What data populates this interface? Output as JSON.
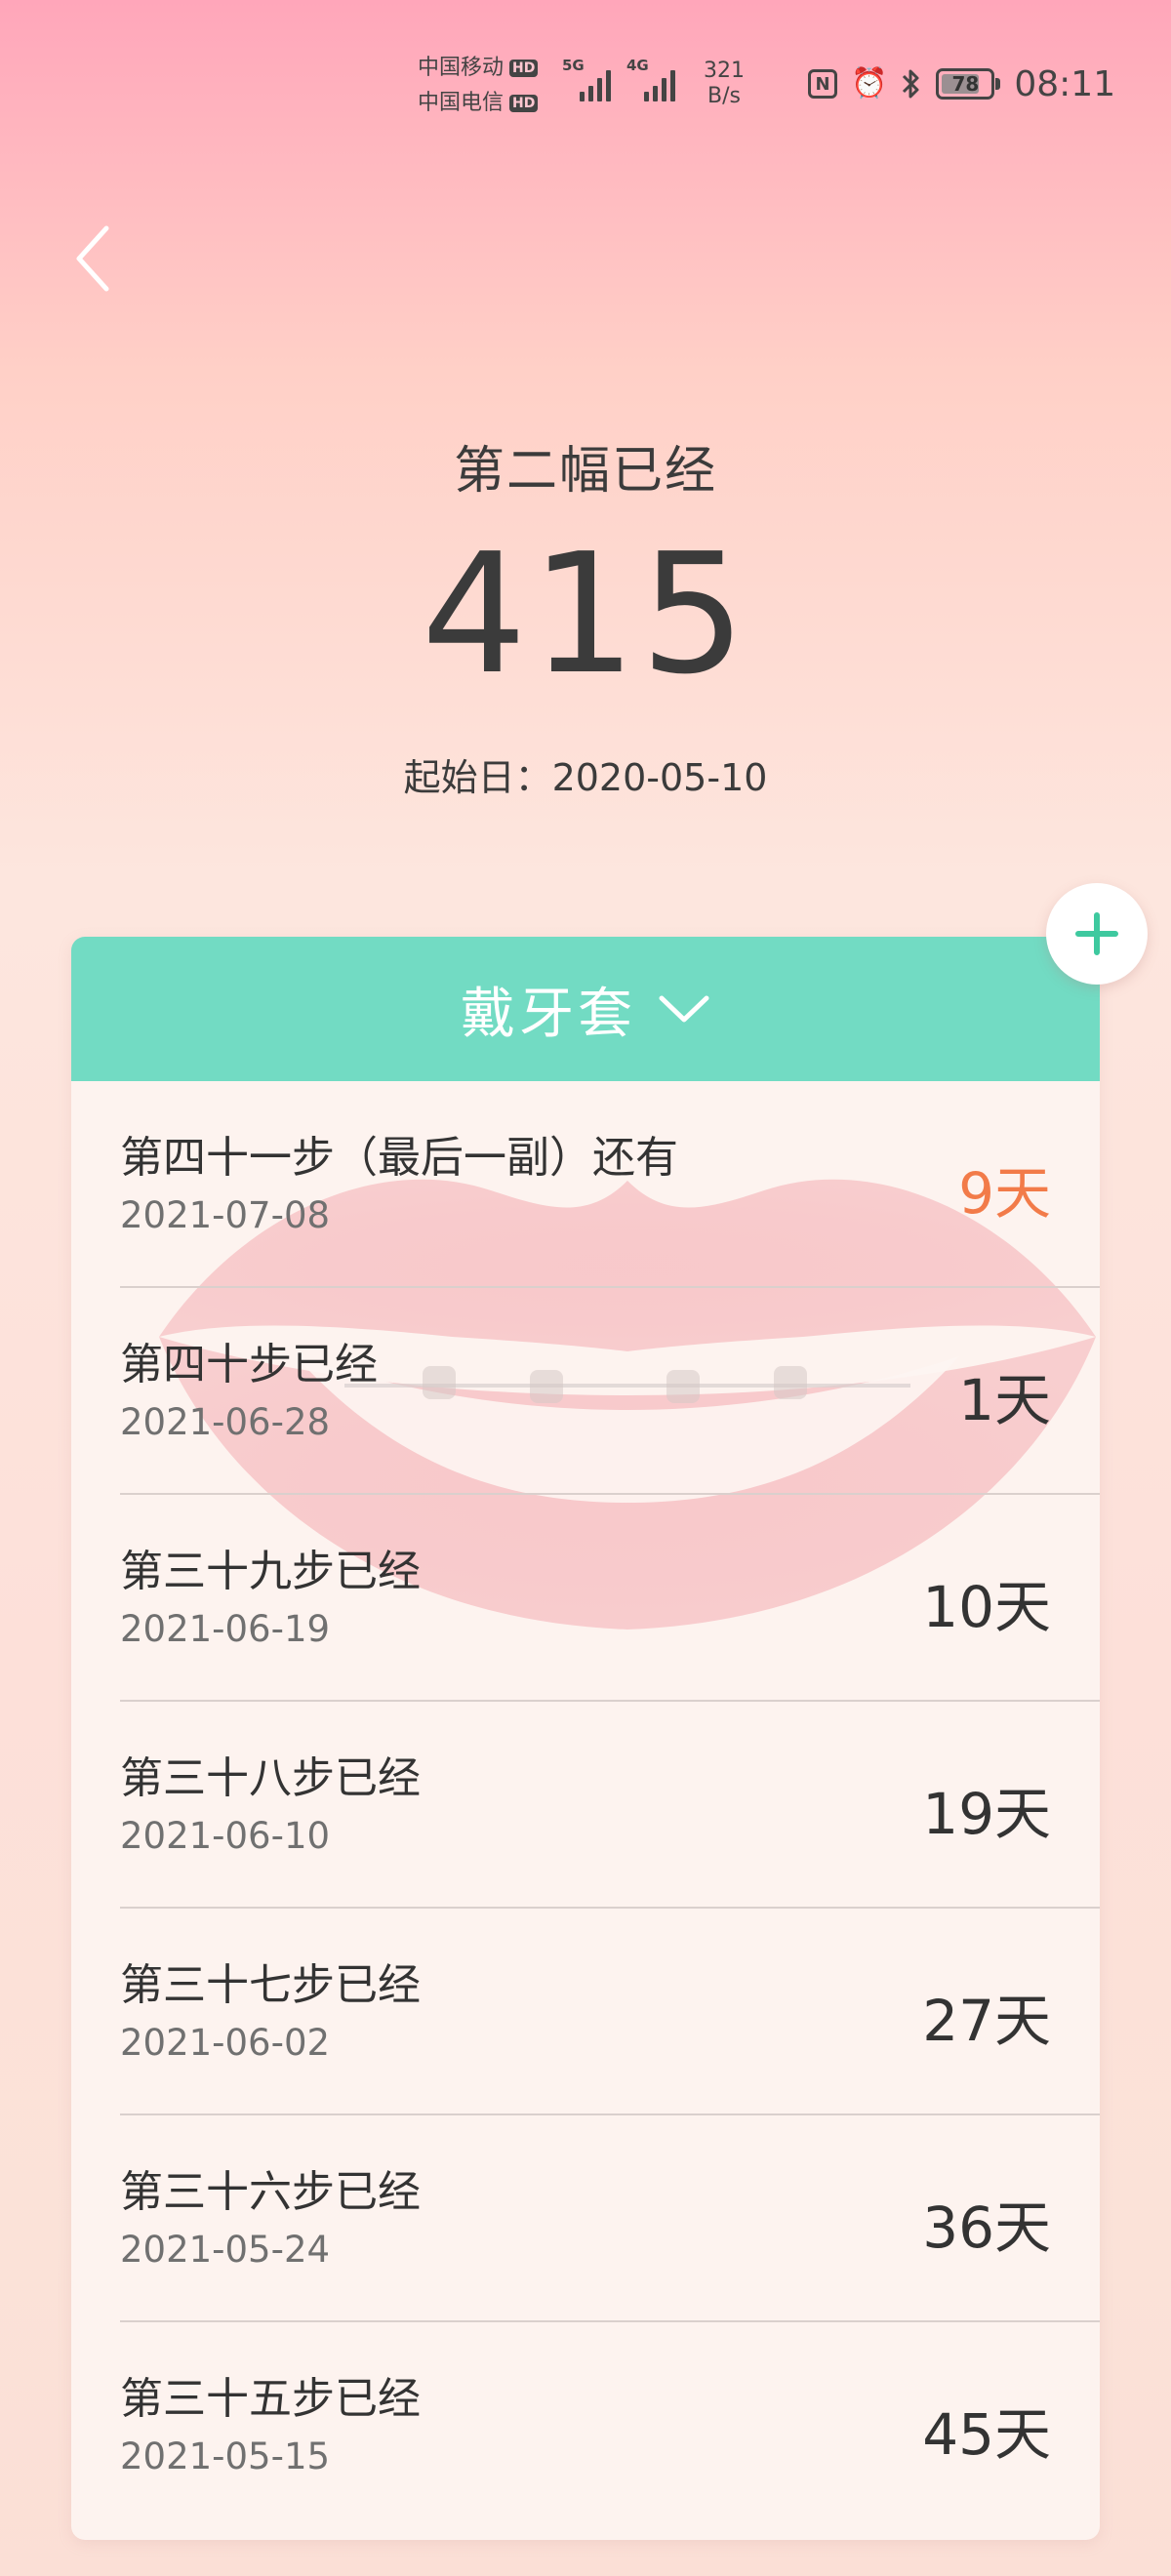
{
  "status_bar": {
    "carrier1": "中国移动",
    "carrier2": "中国电信",
    "hd": "HD",
    "net1": "5G",
    "net2": "4G",
    "speed_value": "321",
    "speed_unit": "B/s",
    "battery": "78",
    "battery_level": 0.78,
    "time": "08:11"
  },
  "header": {
    "title": "第二幅已经",
    "count": "415",
    "start_date": "起始日：2020-05-10"
  },
  "card": {
    "header_label": "戴牙套",
    "items": [
      {
        "title": "第四十一步（最后一副）还有",
        "date": "2021-07-08",
        "days": "9天",
        "highlight": true
      },
      {
        "title": "第四十步已经",
        "date": "2021-06-28",
        "days": "1天",
        "highlight": false
      },
      {
        "title": "第三十九步已经",
        "date": "2021-06-19",
        "days": "10天",
        "highlight": false
      },
      {
        "title": "第三十八步已经",
        "date": "2021-06-10",
        "days": "19天",
        "highlight": false
      },
      {
        "title": "第三十七步已经",
        "date": "2021-06-02",
        "days": "27天",
        "highlight": false
      },
      {
        "title": "第三十六步已经",
        "date": "2021-05-24",
        "days": "36天",
        "highlight": false
      },
      {
        "title": "第三十五步已经",
        "date": "2021-05-15",
        "days": "45天",
        "highlight": false
      }
    ]
  },
  "colors": {
    "accent": "#72dbc3",
    "highlight": "#f27b49",
    "text": "#333333"
  },
  "icons": {
    "back": "chevron-left-icon",
    "dropdown": "chevron-down-icon",
    "add": "plus-icon"
  }
}
